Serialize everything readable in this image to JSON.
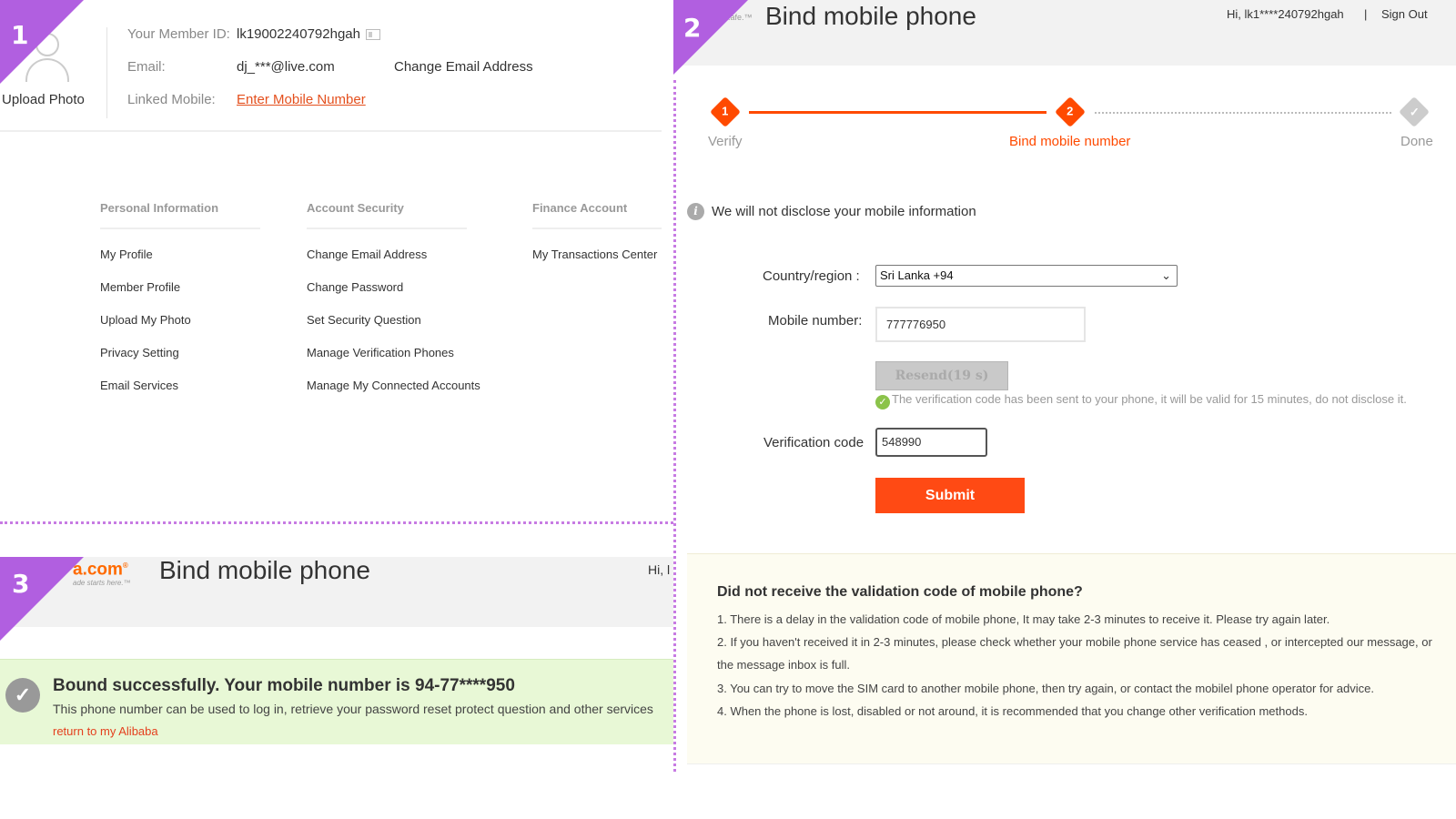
{
  "steps": [
    "1",
    "2",
    "3"
  ],
  "panel1": {
    "upload_photo": "Upload Photo",
    "member_id_label": "Your Member ID:",
    "member_id": "lk19002240792hgah",
    "email_label": "Email:",
    "email": "dj_***@live.com",
    "change_email": "Change Email Address",
    "linked_mobile_label": "Linked Mobile:",
    "enter_mobile": "Enter Mobile Number",
    "menus": [
      {
        "heading": "Personal Information",
        "items": [
          "My Profile",
          "Member Profile",
          "Upload My Photo",
          "Privacy Setting",
          "Email Services"
        ]
      },
      {
        "heading": "Account Security",
        "items": [
          "Change Email Address",
          "Change Password",
          "Set Security Question",
          "Manage Verification Phones",
          "Manage My Connected Accounts"
        ]
      },
      {
        "heading": "Finance Account",
        "items": [
          "My Transactions Center"
        ]
      }
    ]
  },
  "panel2": {
    "logo_fragment": "...afe.™",
    "title": "Bind mobile phone",
    "greeting": "Hi, lk1****240792hgah",
    "separator": "|",
    "sign_out": "Sign Out",
    "progress": [
      {
        "number": "1",
        "label": "Verify",
        "state": "done-active"
      },
      {
        "number": "2",
        "label": "Bind mobile number",
        "state": "current"
      },
      {
        "number": "✓",
        "label": "Done",
        "state": "pending"
      }
    ],
    "disclose_note": "We will not disclose your mobile information",
    "country_label": "Country/region :",
    "country_value": "Sri Lanka +94",
    "mobile_label": "Mobile number:",
    "mobile_value": "777776950",
    "resend_label": "Resend(19 s)",
    "sent_message": "The verification code has been sent to your phone, it will be valid for 15 minutes, do not disclose it.",
    "code_label": "Verification code",
    "code_value": "548990",
    "submit_label": "Submit",
    "help": {
      "title": "Did not receive the validation code of mobile phone?",
      "lines": [
        "1. There is a delay in the validation code of mobile phone,  It may take 2-3 minutes to receive it. Please try again later.",
        "2. If you haven't received it in 2-3 minutes, please check whether your mobile phone service has ceased , or intercepted our message, or the message inbox is full.",
        "3. You can try to move the SIM card to another mobile phone, then try again, or contact the mobilel phone operator for advice.",
        "4. When the phone is lost, disabled or not around, it is recommended that you change other verification methods."
      ]
    }
  },
  "panel3": {
    "logo_text": "a.com",
    "logo_tagline": "ade starts here.™",
    "title": "Bind mobile phone",
    "greeting": "Hi, l",
    "success_title": "Bound successfully. Your mobile number is 94-77****950",
    "success_desc": "This phone number can be used to log in, retrieve your password reset protect question and other services",
    "return_link": "return to my Alibaba"
  },
  "colors": {
    "ribbon": "#b15fe0",
    "accent_orange": "#ff4a00",
    "success_bg": "#e8f8d6",
    "help_bg": "#fdfcf1"
  }
}
